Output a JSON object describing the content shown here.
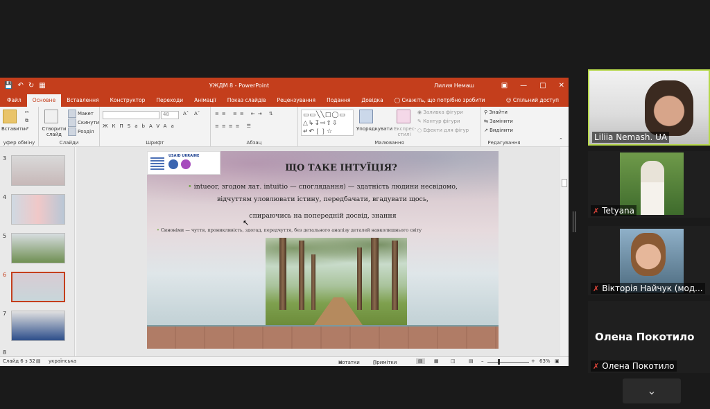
{
  "app": {
    "title": "УЖДМ 8  -  PowerPoint",
    "user": "Лилия Немаш",
    "quick_access": [
      "save-icon",
      "undo-icon",
      "redo-icon",
      "present-icon"
    ],
    "window_controls": [
      "ribbon-options-icon",
      "minimize-icon",
      "maximize-icon",
      "close-icon"
    ]
  },
  "ribbon_tabs": [
    "Файл",
    "Основне",
    "Вставлення",
    "Конструктор",
    "Переходи",
    "Анімації",
    "Показ слайдів",
    "Рецензування",
    "Подання",
    "Довідка"
  ],
  "tell_me": "Скажіть, що потрібно зробити",
  "share": "Спільний доступ",
  "ribbon": {
    "clipboard": {
      "paste": "Вставити",
      "label": "уфер обміну"
    },
    "slides": {
      "new_slide": "Створити слайд",
      "layout": "Макет",
      "reset": "Скинути",
      "section": "Розділ",
      "label": "Слайди"
    },
    "font": {
      "size": "48",
      "formatting": [
        "Ж",
        "К",
        "П",
        "S",
        "ab",
        "AV",
        "Aa"
      ],
      "label": "Шрифт"
    },
    "paragraph": {
      "label": "Абзац"
    },
    "drawing": {
      "arrange": "Упорядкувати",
      "quick_styles": "Експрес-стилі",
      "fill": "Заливка фігури",
      "outline": "Контур фігури",
      "effects": "Ефекти для фігур",
      "label": "Малювання"
    },
    "editing": {
      "find": "Знайти",
      "replace": "Замінити",
      "select": "Виділити",
      "label": "Редагування"
    }
  },
  "thumbnails": {
    "numbers": [
      "3",
      "4",
      "5",
      "6",
      "7",
      "8"
    ],
    "selected": "6"
  },
  "slide": {
    "logo_text": "USAID UKRAINE",
    "title": "ЩО ТАКЕ ІНТУЇЦІЯ?",
    "line1": "intuеor, згодом лат. intuitio — споглядання) — здатність людини несвідомо,",
    "line2": "відчуттям уловлювати істину, передбачати, вгадувати щось,",
    "line3": "спираючись на попередній досвід, знання",
    "synonyms": "Синоніми — чуття, проникливість, здогад, передчуття, без детального аналізу деталей навколишнього світу"
  },
  "statusbar": {
    "slide_counter": "Слайд 6 з 32",
    "language": "українська",
    "notes": "Нотатки",
    "comments": "Примітки",
    "zoom": "63%"
  },
  "participants": [
    {
      "name": "Liliia Nemash. UA",
      "muted": false,
      "active": true
    },
    {
      "name": "Tetyana",
      "muted": true,
      "active": false
    },
    {
      "name": "Вікторія Найчук (мод...",
      "muted": true,
      "active": false
    },
    {
      "name": "Олена Покотило",
      "muted": true,
      "active": false,
      "display_name": "Олена Покотило"
    }
  ],
  "colors": {
    "ppt_accent": "#c43e1c",
    "active_speaker": "#b6d84a",
    "muted": "#e0453a"
  }
}
